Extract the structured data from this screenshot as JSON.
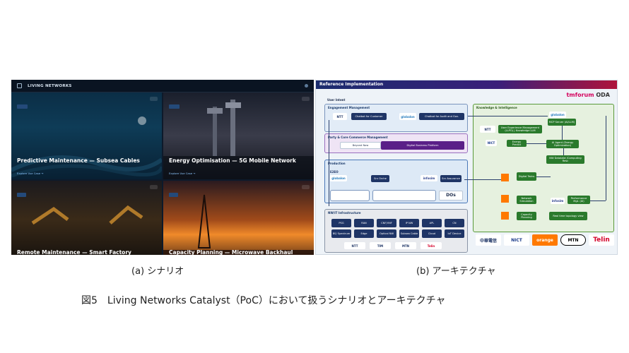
{
  "panel_a": {
    "brand": "LIVING NETWORKS",
    "cards": [
      {
        "title": "Predictive Maintenance — Subsea Cables",
        "cta": "Explore Use Case →"
      },
      {
        "title": "Energy Optimisation — 5G Mobile Network",
        "cta": "Explore Use Case →"
      },
      {
        "title": "Remote Maintenance — Smart Factory",
        "cta": ""
      },
      {
        "title": "Capacity Planning — Microwave Backhaul",
        "cta": ""
      }
    ]
  },
  "panel_b": {
    "header": "Reference Implementation",
    "tmf_a": "tmforum",
    "tmf_b": "ODA",
    "user_intent": "User Intent",
    "engagement": "Engagement Management",
    "chatbot_customer": "Chatbot for Customer",
    "chatbot_audit": "Chatbot for Audit and Gov.",
    "party": "Party & Core Commerce Management",
    "beyond_now": "Beyond Now",
    "digital_platform": "Digital Business Platform",
    "production": "Production",
    "e2eo": "E2EO",
    "srv_order": "Srv Orche",
    "srv_assurance": "Srv Assurance",
    "dos": "DOs",
    "infra": "NW/IT Infrastructure",
    "infra_cells": [
      "PSG",
      "RAN",
      "CNF/VNF",
      "IP NW",
      "APL",
      "CN",
      "BS/ Spectrum",
      "Edge",
      "Optical NW",
      "Subsea Cable",
      "Cloud",
      "IoT Device"
    ],
    "knowledge": "Knowledge & Intelligence",
    "mcp_server": "MCP Server (AI/LLM)",
    "ux_mgmt": "User Experience Management (LLPO) | Knowledge LLM",
    "energy_predict": "Energy Predict",
    "ai_agent": "AI Agent (Energy Optimization)",
    "nw_datalake": "NW Datalake /Computing Resc",
    "digital_twins": "Digital Twins",
    "network_sim": "Network Simulation",
    "perf_mgmt": "Performance Mgt. (AI)",
    "capacity_planning": "Capacity Planning",
    "realtime_view": "Real time topology view",
    "partners_bottom": [
      "NTT",
      "TIM",
      "MTN",
      "Telin"
    ],
    "partners_right": [
      "中華電信",
      "NICT",
      "orange",
      "MTN",
      "Telin"
    ],
    "colors": {
      "navy": "#1f3566",
      "green": "#2a7a2c",
      "orange": "#ff7900",
      "purple": "#5a1f88"
    }
  },
  "captions": {
    "a": "(a) シナリオ",
    "b": "(b) アーキテクチャ",
    "figure": "図5　Living Networks Catalyst（PoC）において扱うシナリオとアーキテクチャ"
  }
}
